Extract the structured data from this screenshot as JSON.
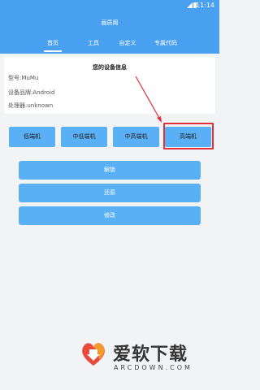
{
  "status_bar": {
    "time": "11:14"
  },
  "app_bar": {
    "title": "画质阁"
  },
  "tabs": [
    {
      "label": "首页",
      "active": true
    },
    {
      "label": "工具",
      "active": false
    },
    {
      "label": "自定义",
      "active": false
    },
    {
      "label": "专属代码",
      "active": false
    }
  ],
  "device_info": {
    "title": "您的设备信息",
    "model": "型号:MuMu",
    "brand": "设备品牌:Android",
    "processor": "处理器:unknown"
  },
  "tier_buttons": [
    "低端机",
    "中低端机",
    "中高端机",
    "高端机"
  ],
  "actions": [
    "解锁",
    "还原",
    "修改"
  ],
  "watermark": {
    "brand": "爱软下载",
    "domain": "ARCDOWN.COM"
  },
  "colors": {
    "primary": "#4aa0f0",
    "button": "#5ab0f5",
    "highlight": "#e0303a"
  }
}
